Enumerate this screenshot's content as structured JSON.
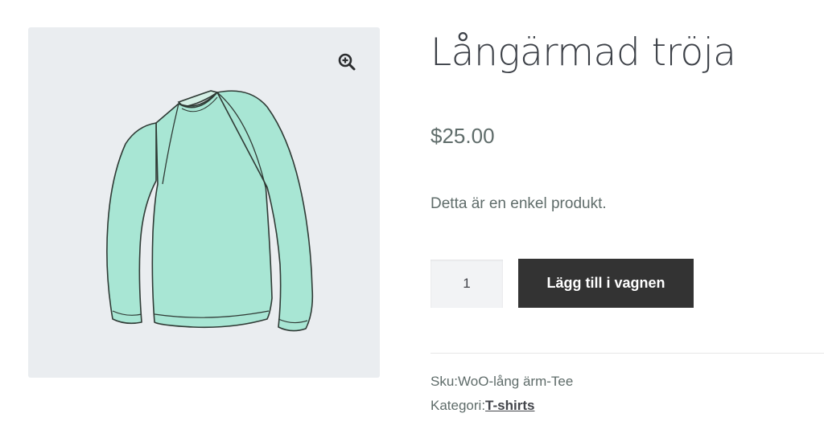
{
  "product": {
    "title": "Långärmad tröja",
    "price": "$25.00",
    "short_description": "Detta är en enkel produkt.",
    "quantity": "1",
    "add_to_cart_label": "Lägg till i vagnen",
    "sku_label": "Sku:",
    "sku_value": "WoO-lång ärm-Tee",
    "category_label": "Kategori:",
    "category_value": "T-shirts"
  },
  "gallery": {
    "zoom_icon": "zoom-in-icon",
    "image": "long-sleeve-tee"
  },
  "colors": {
    "gallery_bg": "#eaedf0",
    "shirt": "#a8e6d4",
    "button_bg": "#333333",
    "text": "#5f6c6a"
  }
}
